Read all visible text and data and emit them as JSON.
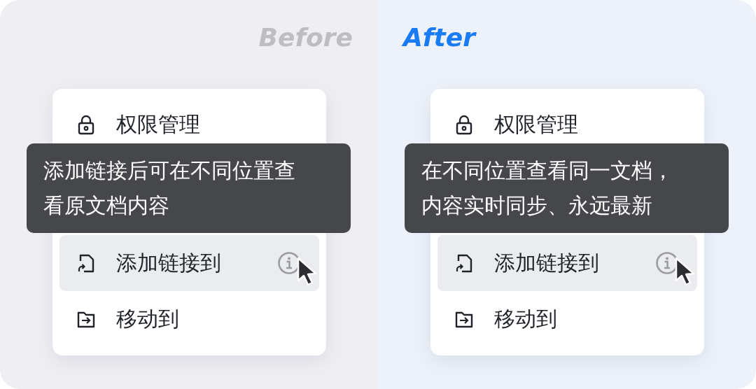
{
  "panels": [
    {
      "heading": "Before",
      "highlight": false,
      "menu": [
        {
          "label": "权限管理",
          "kind": "lock",
          "hovered": false,
          "info": false
        },
        {
          "label": "添加链接到",
          "kind": "link",
          "hovered": true,
          "info": true
        },
        {
          "label": "移动到",
          "kind": "move",
          "hovered": false,
          "info": false
        }
      ],
      "tooltip": [
        "添加链接后可在不同位置查",
        "看原文档内容"
      ]
    },
    {
      "heading": "After",
      "highlight": true,
      "menu": [
        {
          "label": "权限管理",
          "kind": "lock",
          "hovered": false,
          "info": false
        },
        {
          "label": "添加链接到",
          "kind": "link",
          "hovered": true,
          "info": true
        },
        {
          "label": "移动到",
          "kind": "move",
          "hovered": false,
          "info": false
        }
      ],
      "tooltip": [
        "在不同位置查看同一文档，",
        "内容实时同步、永远最新"
      ]
    }
  ]
}
